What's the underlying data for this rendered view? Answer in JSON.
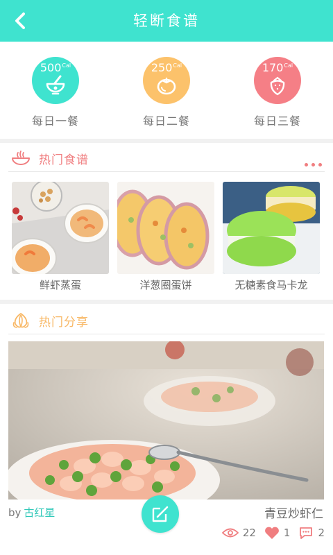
{
  "header": {
    "title": "轻断食谱",
    "back_icon": "chevron-left-icon"
  },
  "meals": [
    {
      "calories": "500",
      "unit": "Cal",
      "label": "每日一餐",
      "color": "#3fe3cf",
      "icon": "mortar-bowl-icon"
    },
    {
      "calories": "250",
      "unit": "Cal",
      "label": "每日二餐",
      "color": "#fcc26b",
      "icon": "tomato-icon"
    },
    {
      "calories": "170",
      "unit": "Cal",
      "label": "每日三餐",
      "color": "#f57f86",
      "icon": "strawberry-icon"
    }
  ],
  "hot_recipes": {
    "title": "热门食谱",
    "title_color": "#f07e80",
    "icon": "bowl-steam-icon",
    "more_icon": "more-dots-icon",
    "items": [
      {
        "name": "鲜虾蒸蛋",
        "image": "shrimp-steamed-egg-photo"
      },
      {
        "name": "洋葱圈蛋饼",
        "image": "onion-ring-omelet-photo"
      },
      {
        "name": "无糖素食马卡龙",
        "image": "sugar-free-macaron-photo"
      }
    ]
  },
  "hot_share": {
    "title": "热门分享",
    "title_color": "#f8b866",
    "icon": "onion-icon",
    "image": "pea-shrimp-photo",
    "by_prefix": "by",
    "author": "古红星",
    "dish": "青豆炒虾仁",
    "views": "22",
    "likes": "1",
    "comments": "2",
    "write_icon": "edit-icon"
  }
}
